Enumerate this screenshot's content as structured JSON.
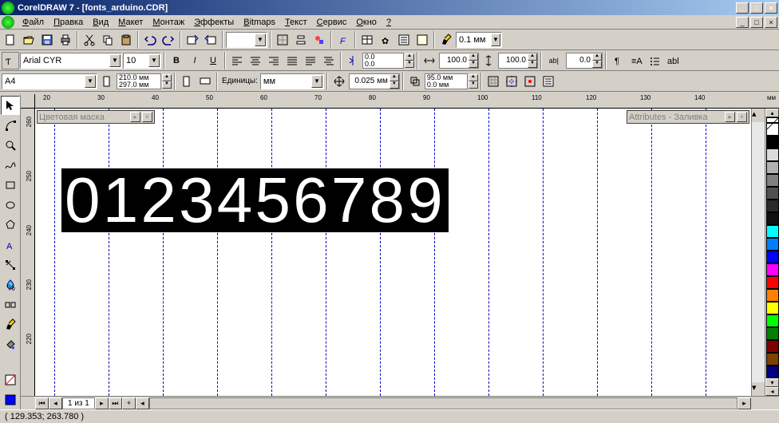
{
  "title": "CorelDRAW 7 - [fonts_arduino.CDR]",
  "menu": [
    "Файл",
    "Правка",
    "Вид",
    "Макет",
    "Монтаж",
    "Эффекты",
    "Bitmaps",
    "Текст",
    "Сервис",
    "Окно",
    "?"
  ],
  "font": {
    "name": "Arial CYR",
    "size": "10"
  },
  "page": {
    "format": "A4",
    "w": "210.0 мм",
    "h": "297.0 мм"
  },
  "units_label": "Единицы:",
  "units_value": "мм",
  "nudge": "0.025 мм",
  "dup": {
    "x": "95.0 мм",
    "y": "0.0 мм"
  },
  "linewidth": "0.1 мм",
  "scale1": "100.0",
  "scale2": "100.0",
  "ab_off1": "0.0",
  "ab_off2": "0.0",
  "kern": "0.0",
  "pager": "1 из 1",
  "status": "( 129.353; 263.780 )",
  "floater1": "Цветовая маска",
  "floater2": "Attributes - Заливка",
  "canvas_text": "0123456789",
  "ruler_h": [
    20,
    30,
    40,
    50,
    60,
    70,
    80,
    90,
    100,
    110,
    120,
    130,
    140
  ],
  "ruler_h_unit": "мм",
  "ruler_v": [
    260,
    250,
    240,
    230,
    220
  ],
  "ruler_v_unit": "мм",
  "palette": [
    "#ffffff",
    "#000000",
    "#dcdcdc",
    "#b0b0b0",
    "#808080",
    "#505050",
    "#2a2a2a",
    "#101010",
    "#00ffff",
    "#0080ff",
    "#0000ff",
    "#ff00ff",
    "#ff0000",
    "#ff8000",
    "#ffff00",
    "#00ff00",
    "#008000",
    "#800000",
    "#804000",
    "#000080"
  ]
}
